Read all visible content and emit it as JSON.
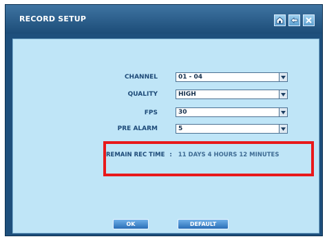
{
  "window": {
    "title": "RECORD SETUP",
    "title_buttons": [
      "home-icon",
      "back-icon",
      "close-icon"
    ]
  },
  "form": {
    "channel": {
      "label": "CHANNEL",
      "value": "01 - 04"
    },
    "quality": {
      "label": "QUALITY",
      "value": "HIGH"
    },
    "fps": {
      "label": "FPS",
      "value": "30"
    },
    "pre_alarm": {
      "label": "PRE ALARM",
      "value": "5"
    }
  },
  "remain": {
    "label": "REMAIN REC TIME",
    "separator": ":",
    "value": "11 DAYS 4 HOURS 12 MINUTES"
  },
  "buttons": {
    "ok": "OK",
    "default": "DEFAULT"
  },
  "colors": {
    "frame": "#1e4f7c",
    "panel": "#bfe5f7",
    "label": "#1d4a78",
    "highlight": "#e8191b"
  }
}
